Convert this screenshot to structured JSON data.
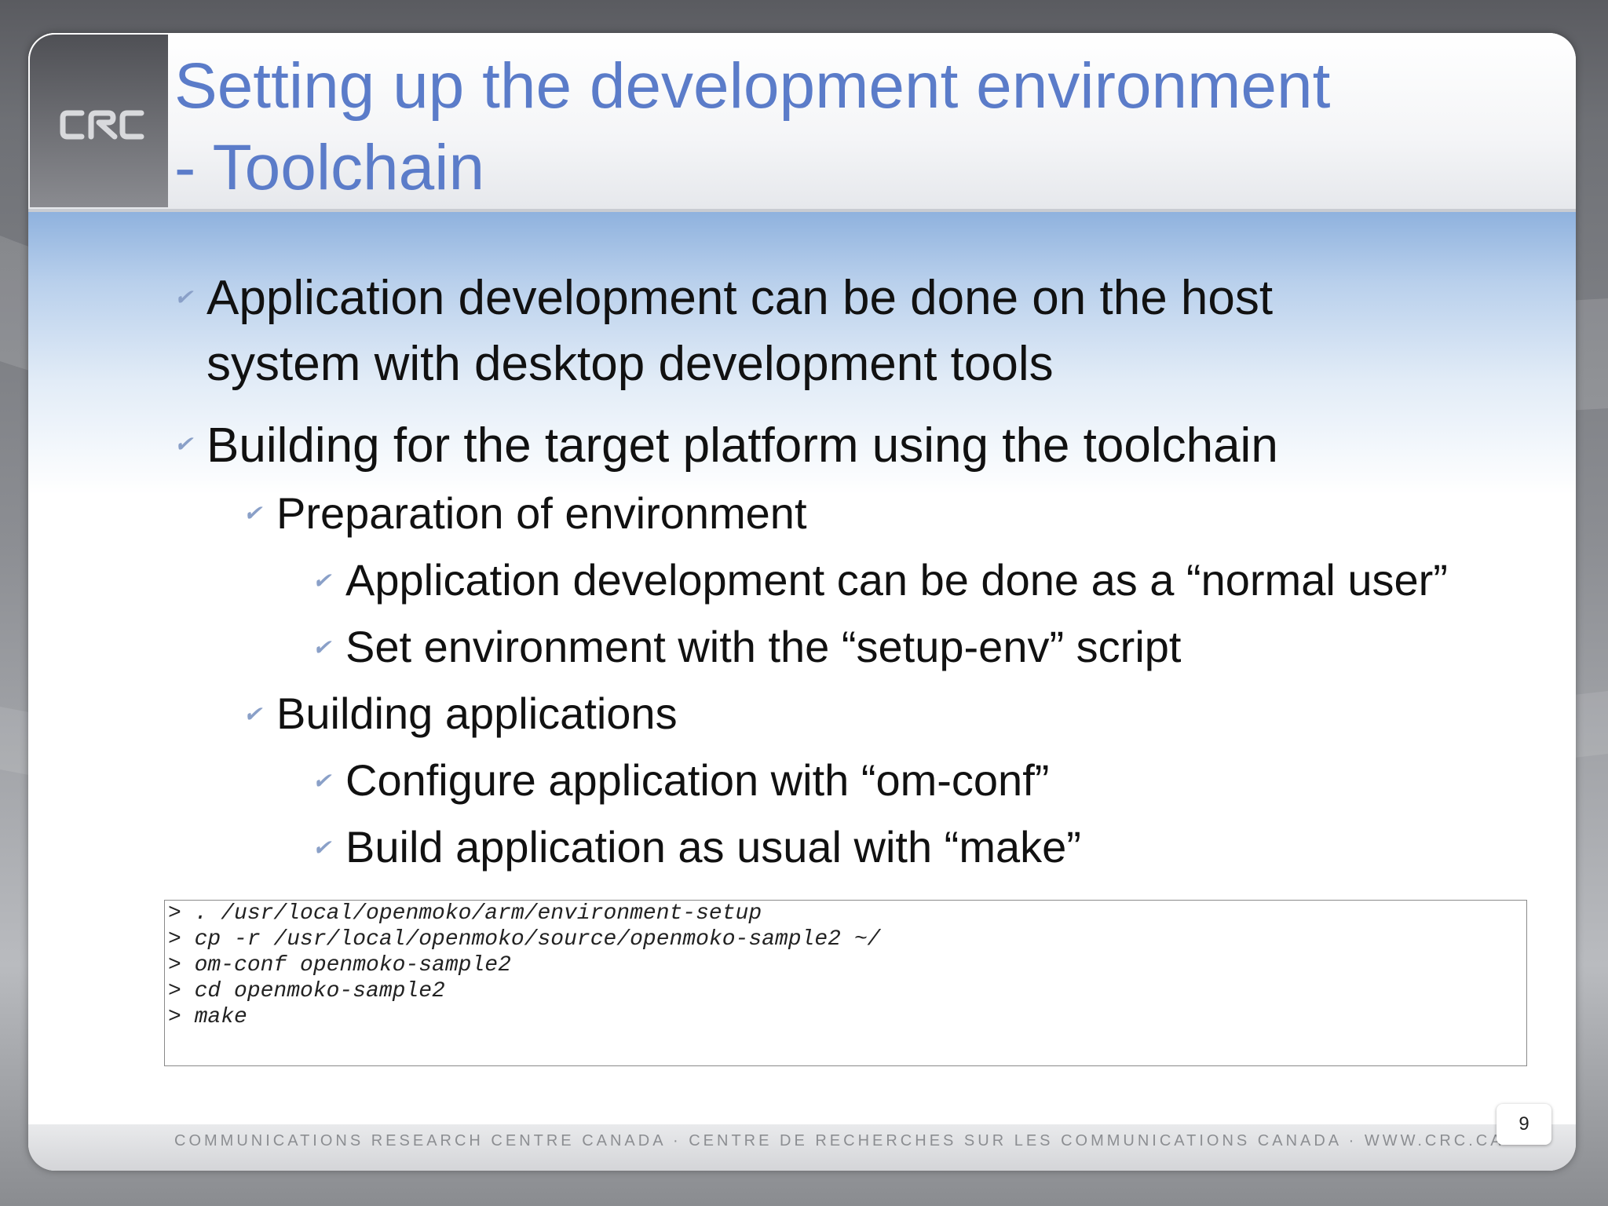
{
  "slide": {
    "title_line1": "Setting up the development environment",
    "title_line2": "- Toolchain",
    "bullets": [
      {
        "text": "Application development can be done on the host",
        "level": 1
      },
      {
        "text": "system with desktop development tools",
        "level": 1
      },
      {
        "text": "Building for the target platform using the toolchain",
        "level": 1
      },
      {
        "text": "Preparation of environment",
        "level": 2
      },
      {
        "text": "Application development can be done as a “normal user”",
        "level": 3
      },
      {
        "text": "Set environment with the “setup-env” script",
        "level": 3
      },
      {
        "text": "Building applications",
        "level": 2
      },
      {
        "text": "Configure application with “om-conf”",
        "level": 3
      },
      {
        "text": "Build application as usual with “make”",
        "level": 3
      }
    ],
    "code_lines": [
      "> . /usr/local/openmoko/arm/environment-setup",
      "> cp -r /usr/local/openmoko/source/openmoko-sample2 ~/",
      "> om-conf openmoko-sample2",
      "> cd openmoko-sample2",
      "> make"
    ],
    "footer": "COMMUNICATIONS RESEARCH CENTRE CANADA  ·  CENTRE DE RECHERCHES SUR LES COMMUNICATIONS CANADA  ·  WWW.CRC.CA",
    "page_number": "9",
    "logo_text": "CRC",
    "bullet_icon": "checkmark-icon"
  },
  "colors": {
    "title": "#5b7cc9",
    "bullet_check": "#8aa0c8",
    "text": "#111111"
  }
}
